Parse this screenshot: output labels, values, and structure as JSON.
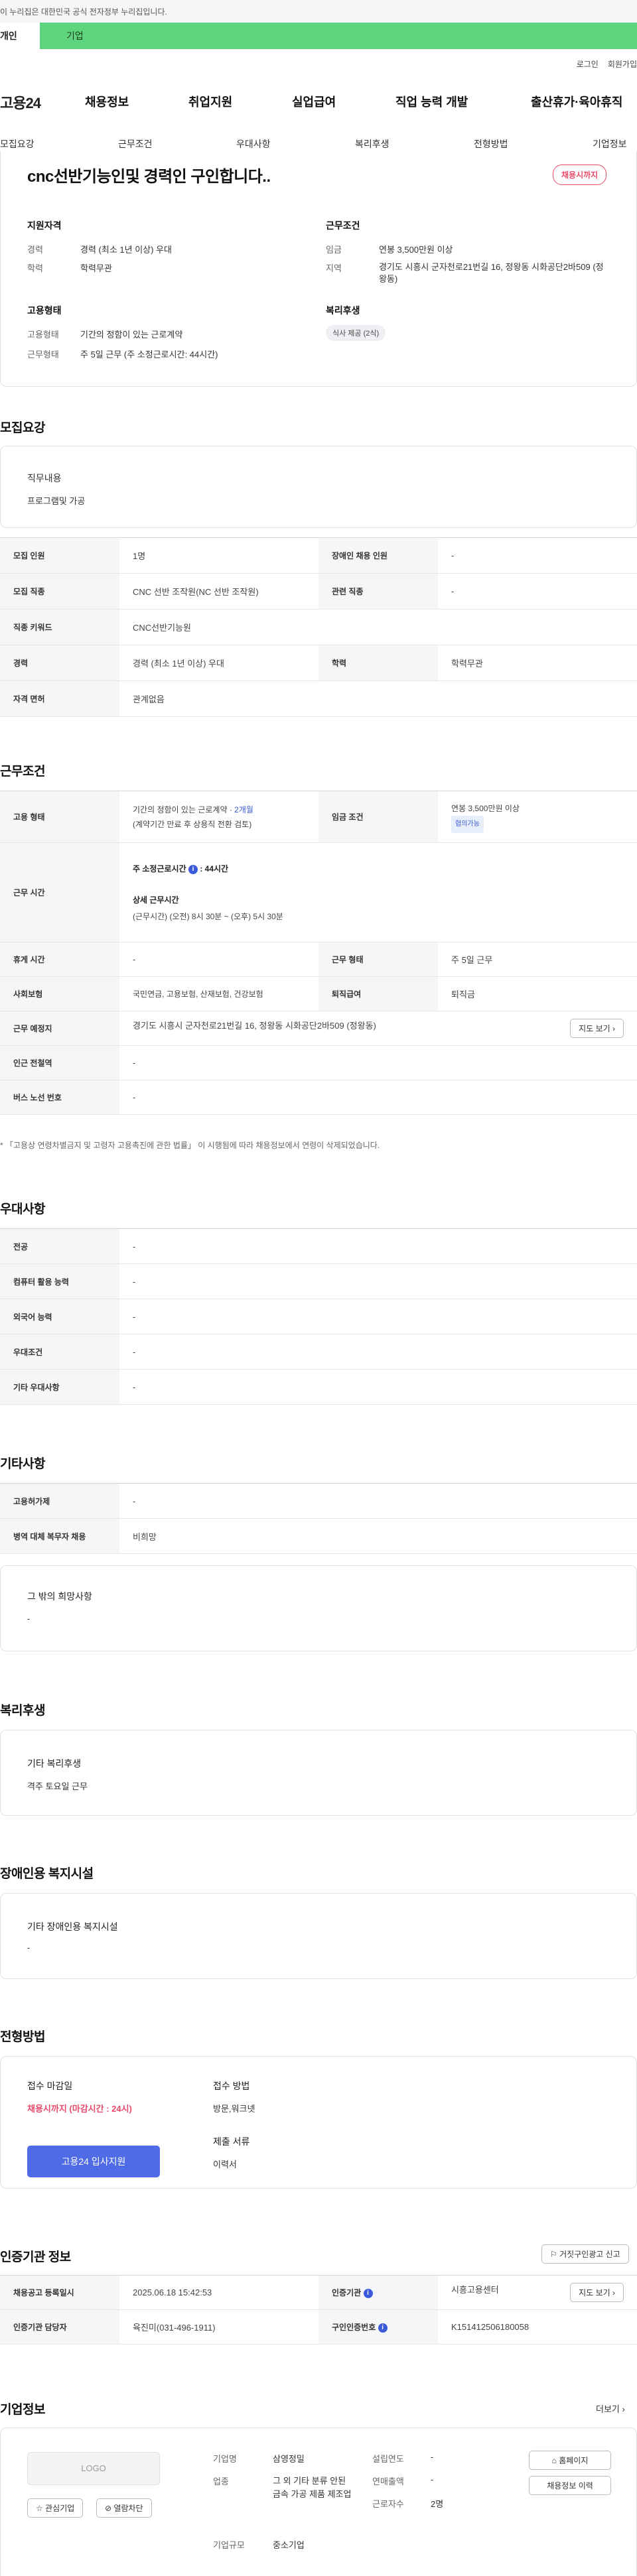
{
  "gov_banner": "이 누리집은 대한민국 공식 전자정부 누리집입니다.",
  "top_tabs": [
    "개인",
    "기업"
  ],
  "util": [
    "로그인",
    "회원가입"
  ],
  "brand": "고용24",
  "gnb": [
    "채용정보",
    "취업지원",
    "실업급여",
    "직업 능력 개발",
    "출산휴가·육아휴직"
  ],
  "subnav": [
    "모집요강",
    "근무조건",
    "우대사항",
    "복리후생",
    "전형방법",
    "기업정보"
  ],
  "summary": {
    "title": "cnc선반기능인및 경력인 구인합니다..",
    "status": "채용시까지",
    "qual_heading": "지원자격",
    "career_label": "경력",
    "career_value": "경력 (최소 1년 이상) 우대",
    "edu_label": "학력",
    "edu_value": "학력무관",
    "cond_heading": "근무조건",
    "wage_label": "임금",
    "wage_value": "연봉 3,500만원 이상",
    "area_label": "지역",
    "area_value": "경기도 시흥시 군자천로21번길 16, 정왕동 시화공단2바509 (정왕동)",
    "emp_heading": "고용형태",
    "emptype_label": "고용형태",
    "emptype_value": "기간의 정함이 있는 근로계약",
    "worktype_label": "근무형태",
    "worktype_value": "주 5일 근무 (주 소정근로시간: 44시간)",
    "welfare_heading": "복리후생",
    "welfare_chip": "식사 제공 (2식)"
  },
  "recruit": {
    "heading": "모집요강",
    "duty_title": "직무내용",
    "duty_value": "프로그램및 가공",
    "rows": [
      [
        "모집 인원",
        "1명",
        "장애인 채용 인원",
        "-"
      ],
      [
        "모집 직종",
        "CNC 선반 조작원(NC 선반 조작원)",
        "관련 직종",
        "-"
      ],
      [
        "직종 키워드",
        "CNC선반기능원"
      ],
      [
        "경력",
        "경력 (최소 1년 이상) 우대",
        "학력",
        "학력무관"
      ],
      [
        "자격 면허",
        "관계없음"
      ]
    ]
  },
  "work": {
    "heading": "근무조건",
    "emp_label": "고용 형태",
    "emp_value": "기간의 정함이 있는 근로계약 · ",
    "emp_period": "2개월",
    "emp_note": "(계약기간 만료 후 상용직 전환 검토)",
    "wage_label": "임금 조건",
    "wage_value": "연봉 3,500만원 이상",
    "wage_badge": "협의가능",
    "time_label": "근무 시간",
    "time_week": "주 소정근로시간",
    "time_week_val": ": 44시간",
    "time_detail_title": "상세 근무시간",
    "time_detail": "(근무시간) (오전) 8시 30분 ~ (오후) 5시 30분",
    "rest_label": "휴게 시간",
    "rest_value": "-",
    "form_label": "근무 형태",
    "form_value": "주 5일 근무",
    "ins_label": "사회보험",
    "ins_value": "국민연금, 고용보험, 산재보험, 건강보험",
    "sev_label": "퇴직급여",
    "sev_value": "퇴직금",
    "place_label": "근무 예정지",
    "place_value": "경기도 시흥시 군자천로21번길 16, 정왕동 시화공단2바509 (정왕동)",
    "map_btn": "지도 보기",
    "sub_label": "인근 전철역",
    "sub_value": "-",
    "bus_label": "버스 노선 번호",
    "bus_value": "-",
    "footnote": "「고용상 연령차별금지 및 고령자 고용촉진에 관한 법률」 이 시행됨에 따라 채용정보에서 연령이 삭제되었습니다."
  },
  "pref": {
    "heading": "우대사항",
    "rows": [
      [
        "전공",
        "-"
      ],
      [
        "컴퓨터 활용 능력",
        "-"
      ],
      [
        "외국어 능력",
        "-"
      ],
      [
        "우대조건",
        "-"
      ],
      [
        "기타 우대사항",
        "-"
      ]
    ]
  },
  "etc": {
    "heading": "기타사항",
    "rows": [
      [
        "고용허가제",
        "-"
      ],
      [
        "병역 대체 복무자 채용",
        "비희망"
      ]
    ],
    "other_title": "그 밖의 희망사항",
    "other_value": "-"
  },
  "welfare": {
    "heading": "복리후생",
    "title": "기타 복리후생",
    "value": "격주 토요일 근무"
  },
  "disab": {
    "heading": "장애인용 복지시설",
    "title": "기타 장애인용 복지시설",
    "value": "-"
  },
  "process": {
    "heading": "전형방법",
    "deadline_title": "접수 마감일",
    "deadline_value": "채용시까지 (마감시간 : 24시)",
    "apply_btn": "고용24 입사지원",
    "method_title": "접수 방법",
    "method_value": "방문,워크넷",
    "docs_title": "제출 서류",
    "docs_value": "이력서"
  },
  "cert": {
    "heading": "인증기관 정보",
    "report_btn": "거짓구인광고 신고",
    "reg_label": "채용공고 등록일시",
    "reg_value": "2025.06.18 15:42:53",
    "org_label": "인증기관",
    "org_value": "시흥고용센터",
    "map_btn": "지도 보기",
    "mgr_label": "인증기관 담당자",
    "mgr_value": "육진미(031-496-1911)",
    "num_label": "구인인증번호",
    "num_value": "K151412506180058"
  },
  "company": {
    "heading": "기업정보",
    "more": "더보기",
    "logo": "LOGO",
    "fav_btn": "관심기업",
    "block_btn": "열람차단",
    "name_label": "기업명",
    "name_value": "삼영정밀",
    "industry_label": "업종",
    "industry_value": "그 외 기타 분류 안된 금속 가공 제품 제조업",
    "size_label": "기업규모",
    "size_value": "중소기업",
    "year_label": "설립연도",
    "year_value": "-",
    "sales_label": "연매출액",
    "sales_value": "-",
    "emp_label": "근로자수",
    "emp_value": "2명",
    "home_btn": "홈페이지",
    "jobs_btn": "채용정보 이력"
  },
  "colors": {
    "accent": "#4f6be6",
    "green": "#5ed47e",
    "status_pink": "#e84a6a"
  }
}
